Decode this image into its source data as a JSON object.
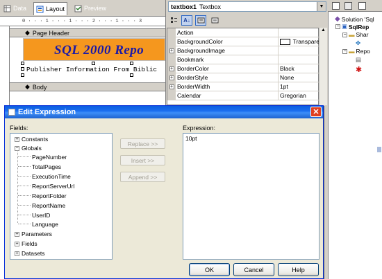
{
  "designer": {
    "tabs": [
      {
        "label": "Data",
        "icon": "data-tab-icon"
      },
      {
        "label": "Layout",
        "icon": "layout-tab-icon"
      },
      {
        "label": "Preview",
        "icon": "preview-tab-icon"
      }
    ],
    "ruler": "0 · · · 1 · · · 1 · · · 2 · · · 1 · · · 3",
    "page_header_label": "Page Header",
    "report_title": "SQL 2000 Repo",
    "publisher_text": "Publisher Information From Biblic",
    "body_label": "Body",
    "colors": {
      "title_band": "#f5971e",
      "title_text": "#1a1aa8"
    }
  },
  "properties": {
    "object_name": "textbox1",
    "object_type": "Textbox",
    "rows": [
      {
        "name": "Action",
        "value": "",
        "expandable": false
      },
      {
        "name": "BackgroundColor",
        "value": "Transpare",
        "expandable": false,
        "swatch": true
      },
      {
        "name": "BackgroundImage",
        "value": "",
        "expandable": true
      },
      {
        "name": "Bookmark",
        "value": "",
        "expandable": false
      },
      {
        "name": "BorderColor",
        "value": "Black",
        "expandable": true
      },
      {
        "name": "BorderStyle",
        "value": "None",
        "expandable": true
      },
      {
        "name": "BorderWidth",
        "value": "1pt",
        "expandable": true
      },
      {
        "name": "Calendar",
        "value": "Gregorian",
        "expandable": false
      }
    ]
  },
  "solution": {
    "items": [
      {
        "label": "Solution 'Sql",
        "icon": "solution-icon"
      },
      {
        "label": "SqlRep",
        "icon": "project-icon"
      },
      {
        "label": "Shar",
        "icon": "folder-icon"
      },
      {
        "label": "Repo",
        "icon": "folder-icon"
      }
    ]
  },
  "dialog": {
    "title": "Edit Expression",
    "fields_label": "Fields:",
    "expression_label": "Expression:",
    "expression_value": "10pt",
    "tree": {
      "constants": "Constants",
      "globals": "Globals",
      "globals_children": [
        "PageNumber",
        "TotalPages",
        "ExecutionTime",
        "ReportServerUrl",
        "ReportFolder",
        "ReportName",
        "UserID",
        "Language"
      ],
      "parameters": "Parameters",
      "fields": "Fields",
      "datasets": "Datasets"
    },
    "buttons": {
      "replace": "Replace >>",
      "insert": "Insert >>",
      "append": "Append >>",
      "ok": "OK",
      "cancel": "Cancel",
      "help": "Help"
    }
  }
}
